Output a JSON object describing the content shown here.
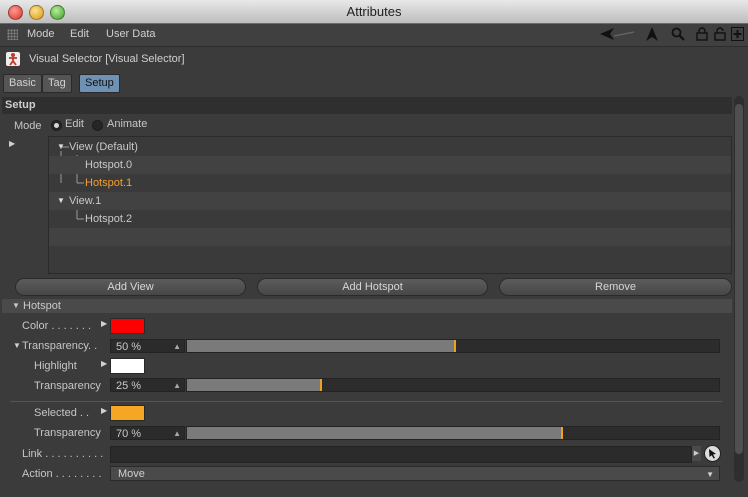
{
  "window": {
    "title": "Attributes"
  },
  "menu": {
    "items": [
      "Mode",
      "Edit",
      "User Data"
    ]
  },
  "toolbar_icons": [
    "back-arrow-icon",
    "up-arrow-icon",
    "search-icon",
    "lock-icon",
    "lock-alt-icon",
    "new-panel-icon"
  ],
  "object": {
    "title": "Visual Selector [Visual Selector]"
  },
  "tabs": [
    {
      "label": "Basic",
      "active": false
    },
    {
      "label": "Tag",
      "active": false
    },
    {
      "label": "Setup",
      "active": true
    }
  ],
  "setup": {
    "header": "Setup",
    "mode_label": "Mode",
    "mode_options": [
      {
        "label": "Edit",
        "selected": true
      },
      {
        "label": "Animate",
        "selected": false
      }
    ]
  },
  "tree": {
    "items": [
      {
        "label": "View (Default)",
        "level": 0,
        "expanded": true,
        "selected": false
      },
      {
        "label": "Hotspot.0",
        "level": 1,
        "selected": false
      },
      {
        "label": "Hotspot.1",
        "level": 1,
        "selected": true
      },
      {
        "label": "View.1",
        "level": 0,
        "expanded": true,
        "selected": false
      },
      {
        "label": "Hotspot.2",
        "level": 1,
        "selected": false
      }
    ]
  },
  "buttons": {
    "add_view": "Add View",
    "add_hotspot": "Add Hotspot",
    "remove": "Remove"
  },
  "hotspot": {
    "header": "Hotspot",
    "color_label": "Color . . . . . . .",
    "color_value": "#ff0000",
    "transparency_label": "Transparency. .",
    "transparency_value": "50 %",
    "transparency_fraction": 0.5,
    "highlight_label": "Highlight",
    "highlight_color": "#ffffff",
    "highlight_transparency_label": "Transparency",
    "highlight_transparency_value": "25 %",
    "highlight_transparency_fraction": 0.25,
    "selected_label": "Selected . .",
    "selected_color": "#f5a623",
    "selected_transparency_label": "Transparency",
    "selected_transparency_value": "70 %",
    "selected_transparency_fraction": 0.7,
    "link_label": "Link . . . . . . . . . .",
    "action_label": "Action . . . . . . . .",
    "action_value": "Move"
  },
  "colors": {
    "accent": "#f0a020",
    "selected_text": "#f5a02a",
    "active_tab": "#6f91b4"
  }
}
